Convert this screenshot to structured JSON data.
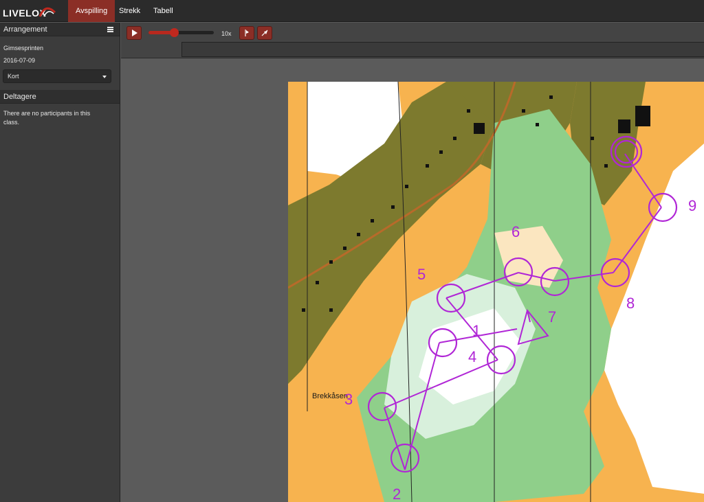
{
  "app": {
    "logo": "LIVELOX",
    "tabs": [
      {
        "label": "Avspilling",
        "active": true
      },
      {
        "label": "Strekk",
        "active": false
      },
      {
        "label": "Tabell",
        "active": false
      }
    ]
  },
  "sidebar": {
    "arrangement_header": "Arrangement",
    "event_name": "Gimsesprinten",
    "event_date": "2016-07-09",
    "class_select": "Kort",
    "participants_header": "Deltagere",
    "participants_empty": "There are no participants in this class."
  },
  "toolbar": {
    "speed_label": "10x",
    "speed_fraction": 0.4
  },
  "map": {
    "place_name": "Brekkåsen",
    "control_labels": [
      "1",
      "2",
      "3",
      "4",
      "5",
      "6",
      "7",
      "8",
      "9"
    ],
    "course_color": "#b026d6",
    "colors": {
      "open": "#f7b34f",
      "forest": "#ffffff",
      "green": "#8fcf8a",
      "urban": "#7d7a2e",
      "building": "#111111"
    }
  }
}
